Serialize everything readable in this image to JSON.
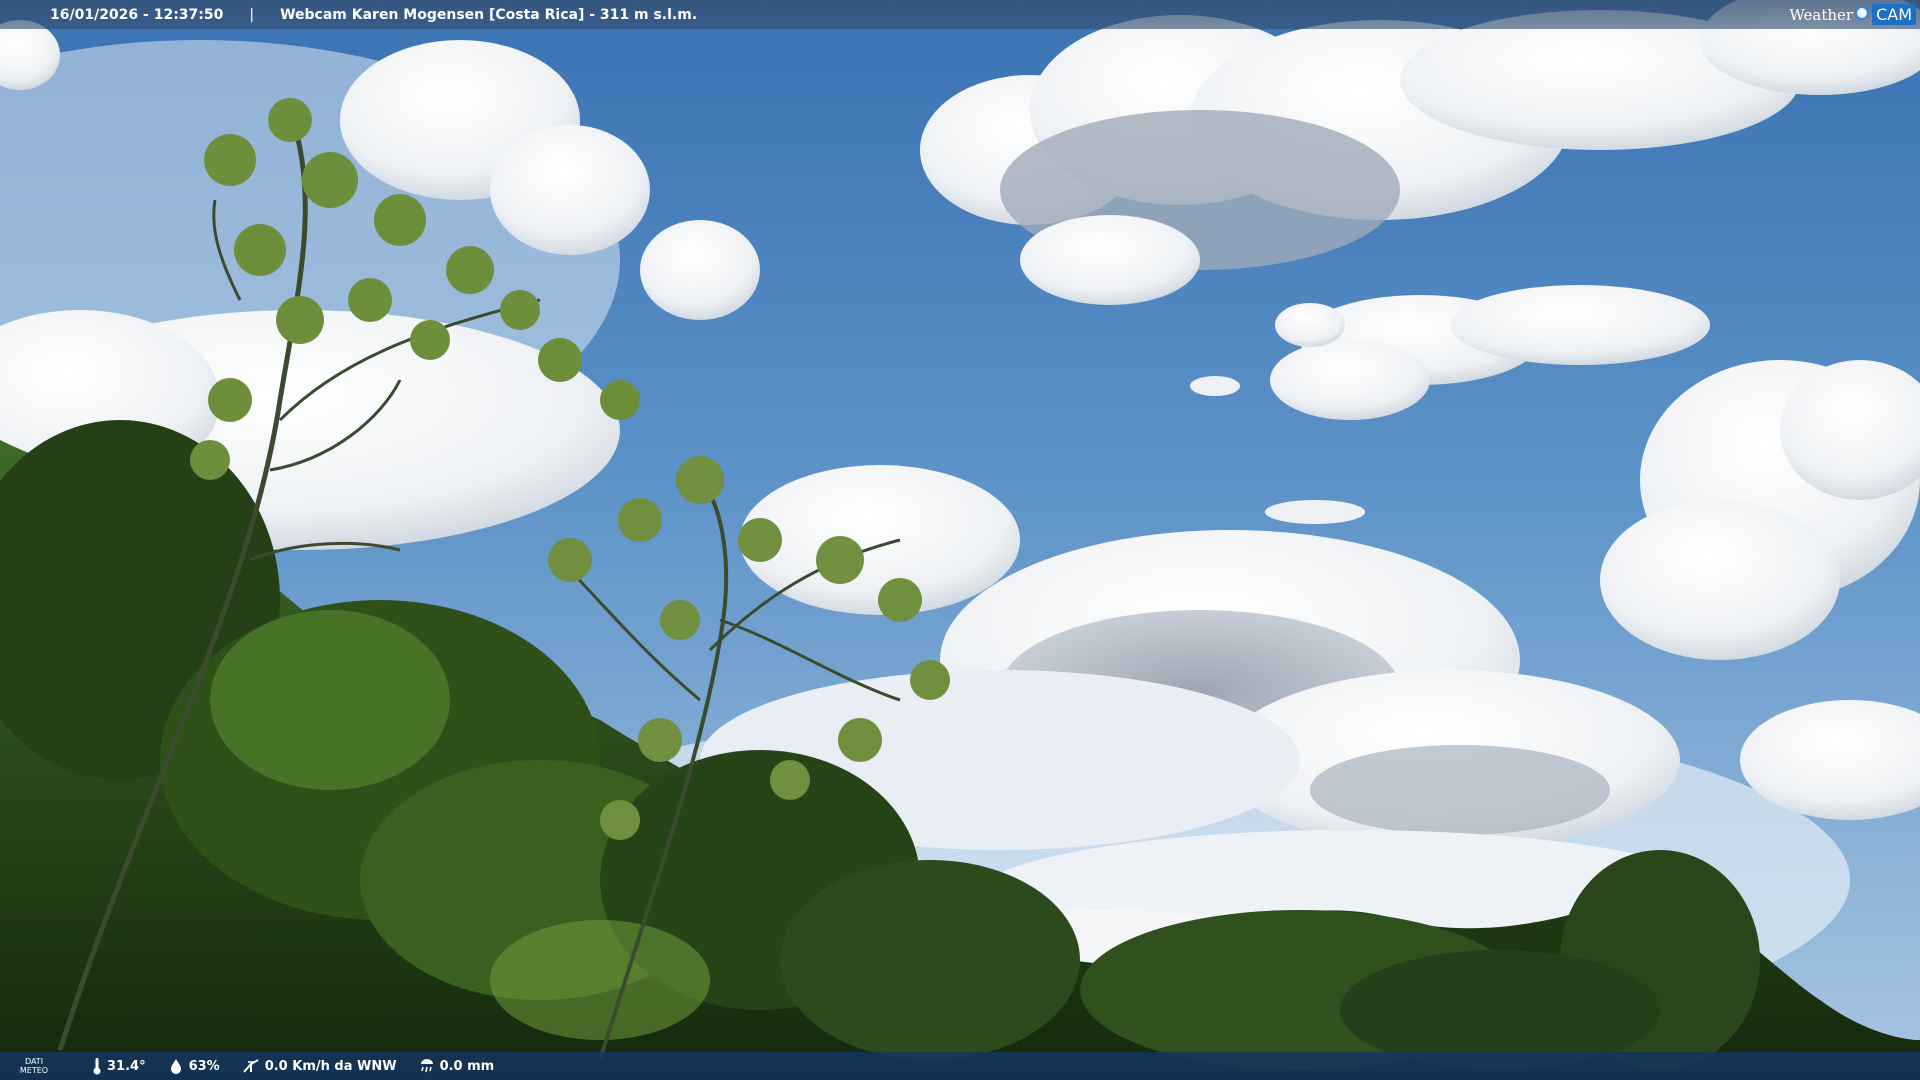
{
  "header": {
    "datetime": "16/01/2026 - 12:37:50",
    "separator": "|",
    "location": "Webcam Karen Mogensen [Costa Rica] - 311 m s.l.m.",
    "brand_weather": "Weather",
    "brand_cam": "CAM"
  },
  "footer": {
    "label_line1": "DATI",
    "label_line2": "METEO",
    "temperature": "31.4°",
    "humidity": "63%",
    "wind": "0.0 Km/h da WNW",
    "rain": "0.0 mm",
    "temperature_icon": "thermometer-icon",
    "humidity_icon": "humidity-drop-icon",
    "wind_icon": "wind-icon",
    "rain_icon": "rain-gauge-icon"
  },
  "colors": {
    "sky_top": "#3f78b8",
    "sky_bottom": "#8fb8df",
    "cloud": "#f4f6f8",
    "foliage_dark": "#1f3a16",
    "foliage_light": "#6f9a3a",
    "header_bar": "#344e70",
    "footer_bar": "#143460",
    "brand_accent": "#1b6fc6"
  }
}
